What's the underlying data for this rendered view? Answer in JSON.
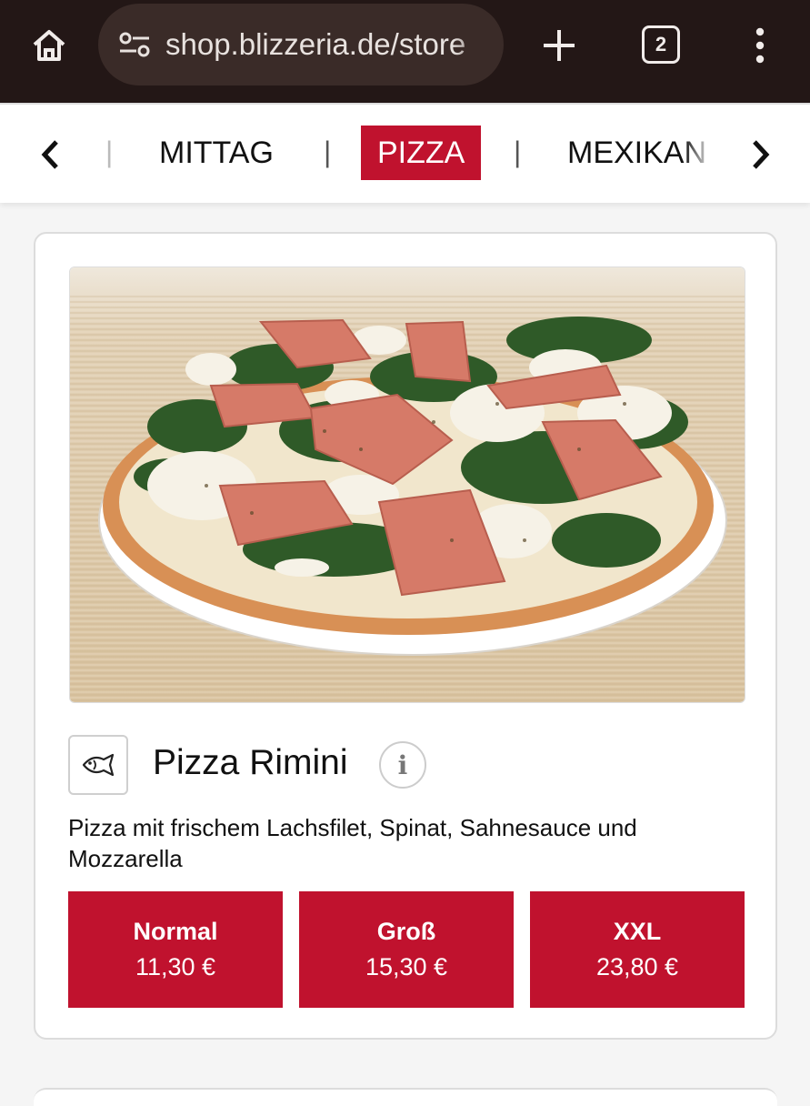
{
  "browser": {
    "url": "shop.blizzeria.de/store",
    "tab_count": "2",
    "icons": {
      "home": "home-icon",
      "site_settings": "tune-icon",
      "new_tab": "plus-icon",
      "menu": "kebab-menu-icon"
    }
  },
  "categories": {
    "items": [
      "MITTAG",
      "PIZZA",
      "MEXIKAN"
    ],
    "active": "PIZZA",
    "separator": "|",
    "accent_color": "#c0122e"
  },
  "product": {
    "title": "Pizza Rimini",
    "badge_icon": "fish-icon",
    "info_label": "i",
    "description": "Pizza mit frischem Lachsfilet, Spinat, Sahnesauce und Mozzarella",
    "sizes": [
      {
        "name": "Normal",
        "price": "11,30 €"
      },
      {
        "name": "Groß",
        "price": "15,30 €"
      },
      {
        "name": "XXL",
        "price": "23,80 €"
      }
    ]
  }
}
